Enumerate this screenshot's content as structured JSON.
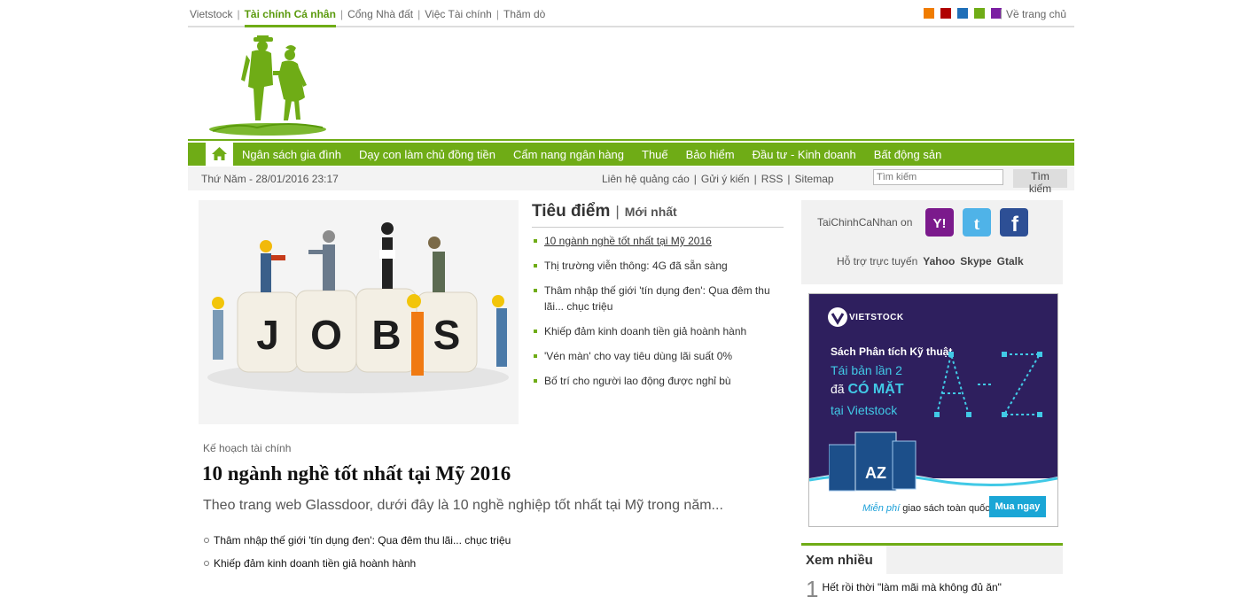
{
  "topnav": {
    "links": [
      "Vietstock",
      "Tài chính Cá nhân",
      "Cổng Nhà đất",
      "Việc Tài chính",
      "Thăm dò"
    ],
    "active_index": 1,
    "home_label": "Về trang chủ",
    "swatch_colors": [
      "#f07c00",
      "#b00000",
      "#1f6fb8",
      "#6fac16",
      "#7b1fa2"
    ]
  },
  "mainnav": {
    "items": [
      "Ngân sách gia đình",
      "Dạy con làm chủ đồng tiền",
      "Cẩm nang ngân hàng",
      "Thuế",
      "Bảo hiểm",
      "Đầu tư - Kinh doanh",
      "Bất động sản"
    ]
  },
  "utility": {
    "date": "Thứ Năm - 28/01/2016 23:17",
    "links": [
      "Liên hệ quảng cáo",
      "Gửi ý kiến",
      "RSS",
      "Sitemap"
    ],
    "search_placeholder": "Tìm kiếm",
    "search_button": "Tìm kiếm"
  },
  "feature_image": {
    "text": "JOBS"
  },
  "focus": {
    "title": "Tiêu điểm",
    "tab2": "Mới nhất",
    "items": [
      "10 ngành nghề tốt nhất tại Mỹ 2016",
      "Thị trường viễn thông: 4G đã sẵn sàng",
      "Thâm nhập thế giới 'tín dụng đen': Qua đêm thu lãi... chục triệu",
      "Khiếp đảm kinh doanh tiền giả hoành hành",
      "'Vén màn' cho vay tiêu dùng lãi suất 0%",
      "Bố trí cho người lao động được nghỉ bù"
    ]
  },
  "article": {
    "category": "Kế hoạch tài chính",
    "headline": "10 ngành nghề tốt nhất tại Mỹ 2016",
    "lead": "Theo trang web Glassdoor, dưới đây là 10 nghề nghiệp tốt nhất tại Mỹ trong năm...",
    "related": [
      "Thâm nhập thế giới 'tín dụng đen': Qua đêm thu lãi... chục triệu",
      "Khiếp đảm kinh doanh tiền giả hoành hành"
    ]
  },
  "social": {
    "label": "TaiChinhCaNhan on",
    "support_label": "Hỗ trợ trực tuyến",
    "support_links": [
      "Yahoo",
      "Skype",
      "Gtalk"
    ]
  },
  "ad": {
    "brand": "VIETSTOCK",
    "line1": "Sách Phân tích Kỹ thuật",
    "line2": "Tái bản lần 2",
    "line3_prefix": "đã",
    "line3_bold": "CÓ MẶT",
    "line4": "tại Vietstock",
    "az": "AZ",
    "free_italic": "Miễn phí",
    "free_rest": "giao sách toàn quốc",
    "buy": "Mua ngay"
  },
  "most_viewed": {
    "title": "Xem nhiều",
    "items": [
      {
        "num": "1",
        "text": "Hết rồi thời \"làm mãi mà không đủ ăn\""
      }
    ]
  }
}
